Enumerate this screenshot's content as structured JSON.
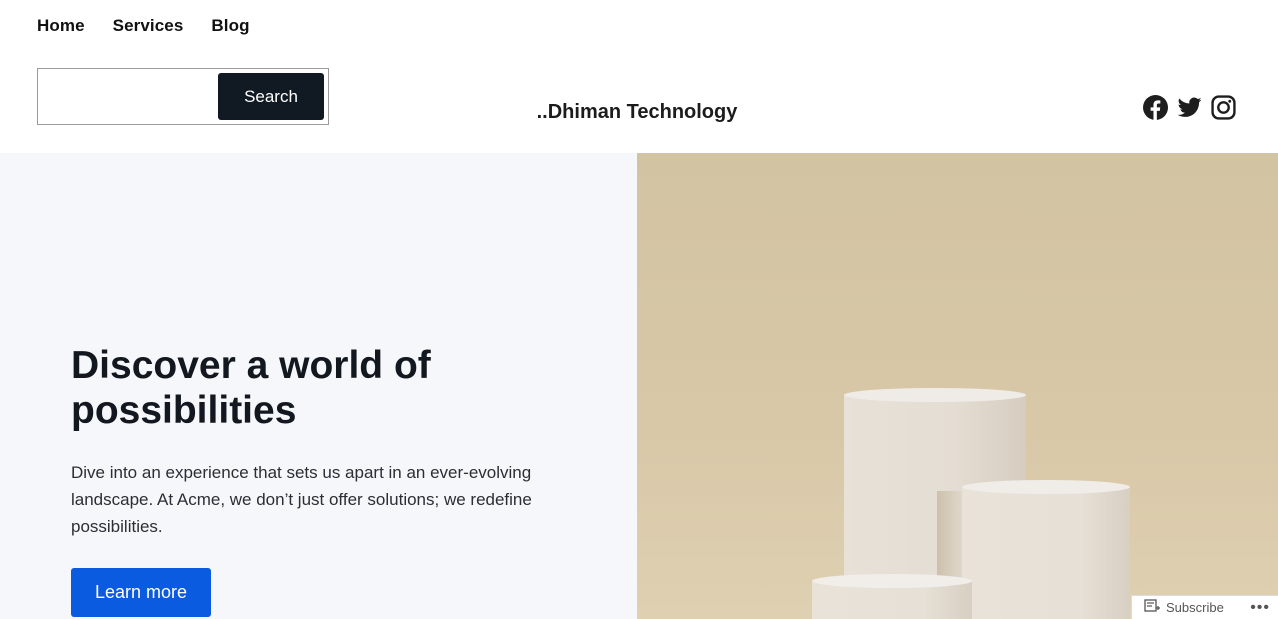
{
  "nav": {
    "items": [
      {
        "label": "Home"
      },
      {
        "label": "Services"
      },
      {
        "label": "Blog"
      }
    ]
  },
  "search": {
    "value": "",
    "placeholder": "",
    "button_label": "Search"
  },
  "site": {
    "title": "..Dhiman Technology"
  },
  "social": {
    "icons": [
      "facebook-icon",
      "twitter-icon",
      "instagram-icon"
    ]
  },
  "hero": {
    "title": "Discover a world of possibilities",
    "text": "Dive into an experience that sets us apart in an ever-evolving landscape. At Acme, we don’t just offer solutions; we redefine possibilities.",
    "button_label": "Learn more",
    "image_icon": "podiums-image"
  },
  "subscribe": {
    "label": "Subscribe",
    "more": "•••"
  },
  "colors": {
    "accent": "#0a5bdf",
    "dark_button": "#111a22",
    "hero_bg": "#f6f7fb",
    "image_bg": "#d4c5a5"
  }
}
